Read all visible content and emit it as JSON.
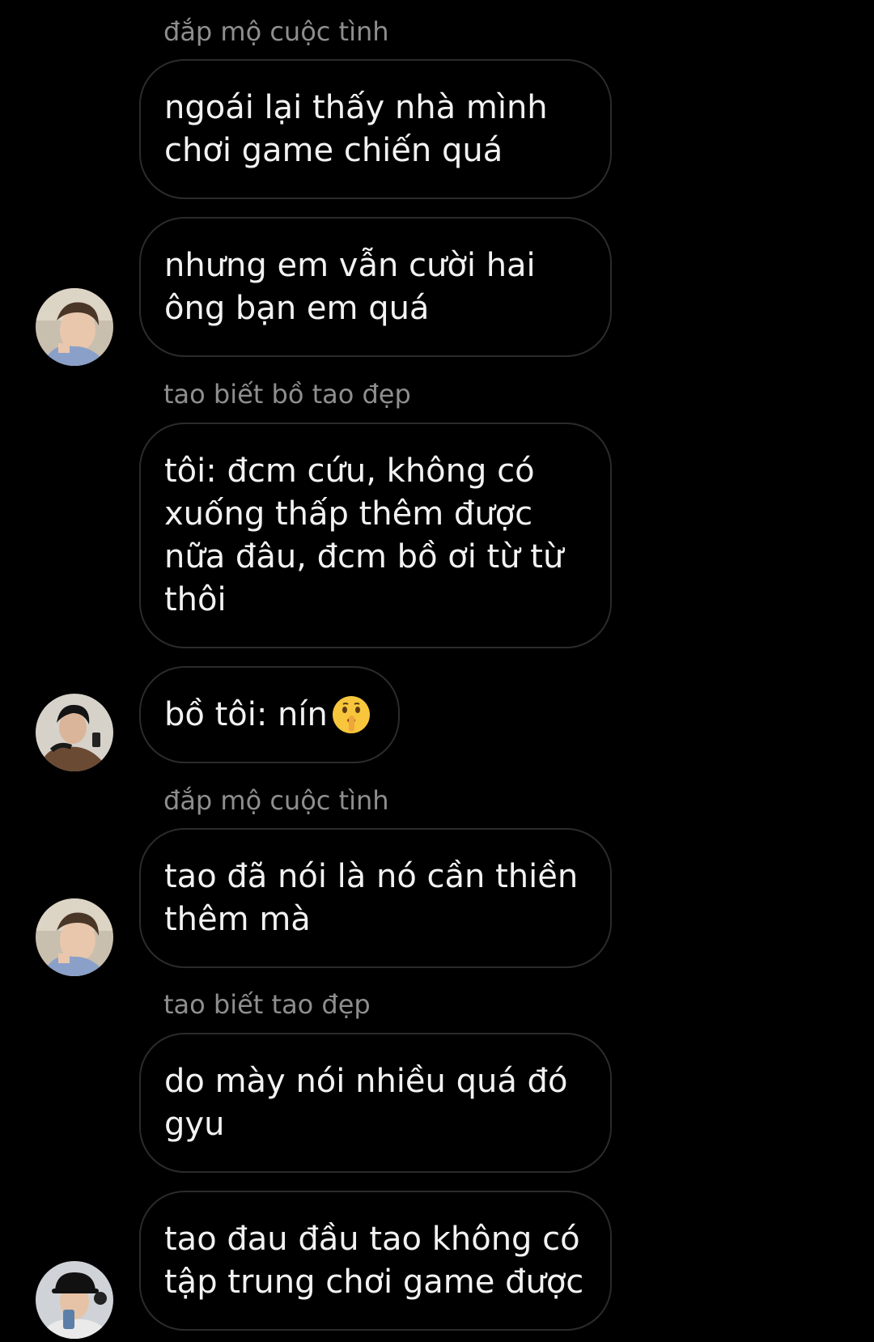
{
  "messages": [
    {
      "sender": "đắp mộ cuộc tình",
      "lines": [
        "ngoái lại thấy nhà mình",
        "chơi game chiến quá"
      ]
    },
    {
      "lines": [
        "nhưng em vẫn cười hai",
        "ông bạn em quá"
      ]
    },
    {
      "sender": "tao biết bồ tao đẹp",
      "lines": [
        "tôi: đcm cứu, không có",
        "xuống thấp thêm được",
        "nữa đâu, đcm bồ ơi từ từ",
        "thôi"
      ]
    },
    {
      "text": "bồ tôi: nín",
      "emoji": "shushing-face-emoji"
    },
    {
      "sender": "đắp mộ cuộc tình",
      "lines": [
        "tao đã nói là nó cần thiền",
        "thêm mà"
      ]
    },
    {
      "sender": "tao biết tao đẹp",
      "lines": [
        "do mày nói nhiều quá đó",
        "gyu"
      ]
    },
    {
      "lines": [
        "tao đau đầu tao không có",
        "tập trung chơi game được"
      ]
    }
  ],
  "avatars": [
    "avatar-user-1",
    "avatar-user-2",
    "avatar-user-1",
    "avatar-user-3"
  ],
  "colors": {
    "background": "#000000",
    "bubble_border": "#2b2b2b",
    "sender_name": "#8e8e8e",
    "message_text": "#f2f2f2"
  }
}
